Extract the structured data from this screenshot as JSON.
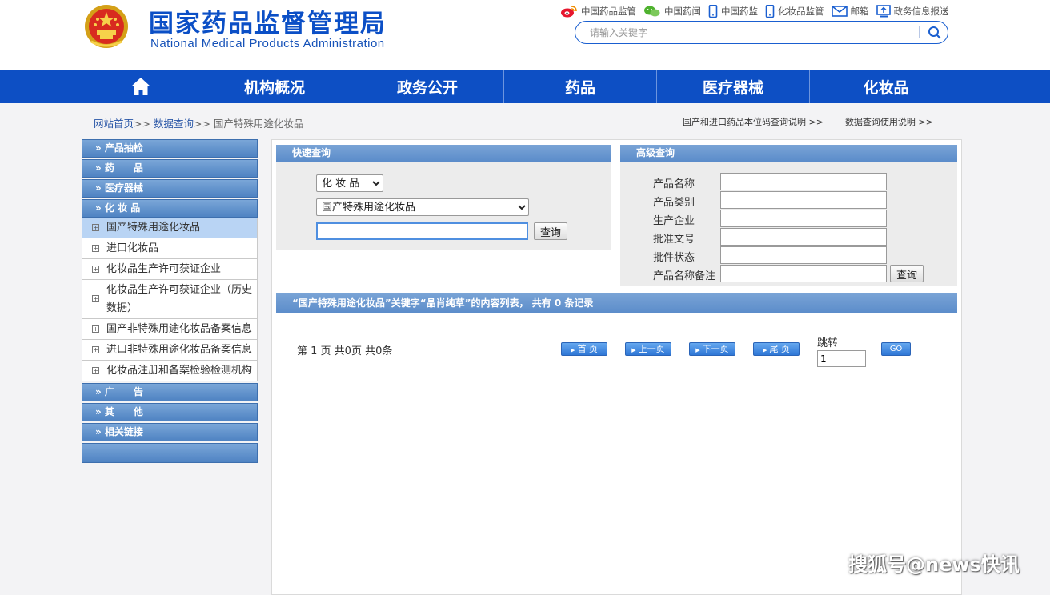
{
  "header": {
    "title": "国家药品监督管理局",
    "subtitle": "National Medical Products Administration",
    "top_links": [
      {
        "label": "中国药品监管",
        "icon": "weibo-icon"
      },
      {
        "label": "中国药闻",
        "icon": "wechat-icon"
      },
      {
        "label": "中国药监",
        "icon": "mobile-icon"
      },
      {
        "label": "化妆品监管",
        "icon": "mobile-icon"
      },
      {
        "label": "邮箱",
        "icon": "mail-icon"
      },
      {
        "label": "政务信息报送",
        "icon": "upload-icon"
      }
    ],
    "search_placeholder": "请输入关键字"
  },
  "nav": {
    "home_icon": "home-icon",
    "items": [
      "机构概况",
      "政务公开",
      "药品",
      "医疗器械",
      "化妆品"
    ]
  },
  "breadcrumb": {
    "home": "网站首页",
    "sep": ">>",
    "level2": "数据查询",
    "current": "国产特殊用途化妆品"
  },
  "help_links": [
    "国产和进口药品本位码查询说明 >>",
    "数据查询使用说明 >>"
  ],
  "sidebar": {
    "top_categories": [
      "» 产品抽检",
      "» 药　　品",
      "» 医疗器械",
      "» 化 妆 品"
    ],
    "sub_items": [
      "国产特殊用途化妆品",
      "进口化妆品",
      "化妆品生产许可获证企业",
      "化妆品生产许可获证企业（历史数据）",
      "国产非特殊用途化妆品备案信息",
      "进口非特殊用途化妆品备案信息",
      "化妆品注册和备案检验检测机构"
    ],
    "bottom_categories": [
      "» 广　　告",
      "» 其　　他",
      "» 相关链接"
    ]
  },
  "quick_query": {
    "title": "快速查询",
    "category_selected": "化 妆 品",
    "subcategory_selected": "国产特殊用途化妆品",
    "keyword_value": "",
    "button": "查询"
  },
  "advanced_query": {
    "title": "高级查询",
    "fields": [
      "产品名称",
      "产品类别",
      "生产企业",
      "批准文号",
      "批件状态",
      "产品名称备注"
    ],
    "button": "查询"
  },
  "results": {
    "summary": "“国产特殊用途化妆品”关键字“晶肖纯草”的内容列表， 共有 0 条记录"
  },
  "pagination": {
    "info": "第 1 页 共0页 共0条",
    "first": "首 页",
    "prev": "上一页",
    "next": "下一页",
    "last": "尾 页",
    "jump_label": "跳转",
    "jump_value": "1",
    "go": "GO"
  },
  "watermark": "搜狐号@news快讯",
  "colors": {
    "brand_blue": "#0d4fc4",
    "panel_blue": "#5b8cca",
    "active_item": "#b9d4f4"
  }
}
